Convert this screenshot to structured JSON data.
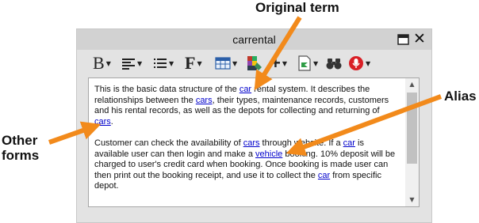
{
  "window": {
    "title": "carrental",
    "restore_icon": "window-restore-icon",
    "close_icon": "close-icon",
    "close_glyph": "✕"
  },
  "toolbar": {
    "items": [
      {
        "name": "bold-tool",
        "glyph": "B",
        "icon": "bold-icon"
      },
      {
        "name": "align-tool",
        "icon": "align-left-icon"
      },
      {
        "name": "list-tool",
        "icon": "list-icon"
      },
      {
        "name": "font-tool",
        "glyph": "F",
        "icon": "font-icon"
      },
      {
        "name": "table-tool",
        "icon": "table-icon"
      },
      {
        "name": "color-tool",
        "icon": "color-grid-icon"
      },
      {
        "name": "insert-tool",
        "glyph": "+",
        "icon": "plus-icon"
      },
      {
        "name": "document-tool",
        "icon": "document-icon"
      },
      {
        "name": "find-tool",
        "icon": "binoculars-icon"
      },
      {
        "name": "record-tool",
        "icon": "microphone-icon"
      }
    ]
  },
  "editor": {
    "p1": {
      "t1": "This is the basic data structure of the ",
      "term1": "car",
      "t2": " rental system. It describes the relationships between the ",
      "term2": "cars",
      "t3": ", their types, maintenance records, customers and his rental records, as well as the depots for collecting and returning of ",
      "term3": "cars",
      "t4": "."
    },
    "p2": {
      "t1": "Customer can check the availability of ",
      "term1": "cars",
      "t2": " through",
      "t3": " website. If a ",
      "term2": "car",
      "t4": " is available user can then login and make a ",
      "term3": "vehicle",
      "t5": " booking. 10% deposit will be charged to user's credit card when booking. Once booking is made user can then print out the booking receipt, and use it to collect the ",
      "term4": "car",
      "t6": " from specific depot."
    },
    "scroll_up_glyph": "▲",
    "scroll_down_glyph": "▼"
  },
  "callouts": {
    "original": "Original term",
    "alias": "Alias",
    "other_line1": "Other",
    "other_line2": "forms",
    "arrow_color": "#f28a1b"
  }
}
